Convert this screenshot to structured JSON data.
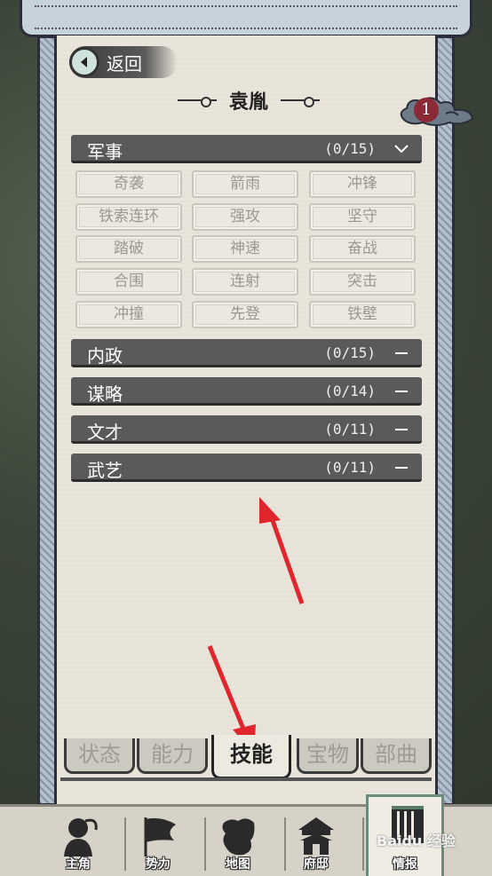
{
  "header": {
    "back_label": "返回",
    "title": "袁胤",
    "badge_count": "1"
  },
  "categories": [
    {
      "name": "军事",
      "count": "(0/15)",
      "state": "expanded"
    },
    {
      "name": "内政",
      "count": "(0/15)",
      "state": "collapsed"
    },
    {
      "name": "谋略",
      "count": "(0/14)",
      "state": "collapsed"
    },
    {
      "name": "文才",
      "count": "(0/11)",
      "state": "collapsed"
    },
    {
      "name": "武艺",
      "count": "(0/11)",
      "state": "collapsed"
    }
  ],
  "military_skills": [
    "奇袭",
    "箭雨",
    "冲锋",
    "铁索连环",
    "强攻",
    "坚守",
    "踏破",
    "神速",
    "奋战",
    "合围",
    "连射",
    "突击",
    "冲撞",
    "先登",
    "铁壁"
  ],
  "tabs": [
    {
      "label": "状态",
      "active": false
    },
    {
      "label": "能力",
      "active": false
    },
    {
      "label": "技能",
      "active": true
    },
    {
      "label": "宝物",
      "active": false
    },
    {
      "label": "部曲",
      "active": false
    }
  ],
  "bottom_nav": [
    {
      "label": "主角",
      "icon": "character-icon"
    },
    {
      "label": "势力",
      "icon": "flag-icon"
    },
    {
      "label": "地图",
      "icon": "map-icon"
    },
    {
      "label": "府邸",
      "icon": "mansion-icon"
    },
    {
      "label": "情报",
      "icon": "intel-scroll-icon",
      "active": true
    }
  ],
  "watermark": "Baidu 经验",
  "colors": {
    "accent_red": "#e0262d",
    "header_gray": "#5a5a5a",
    "paper": "#e9e5da"
  }
}
